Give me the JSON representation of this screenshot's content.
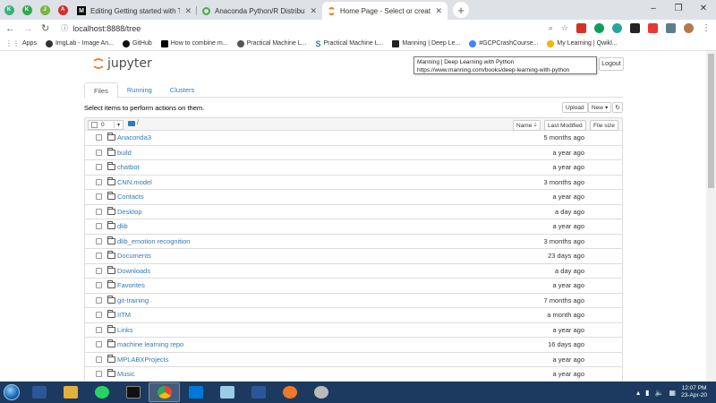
{
  "browser": {
    "tabs": [
      {
        "title": "Editing Getting started with Tens",
        "icon": "medium-icon",
        "active": false
      },
      {
        "title": "Anaconda Python/R Distribution",
        "icon": "anaconda-icon",
        "active": false
      },
      {
        "title": "Home Page - Select or create a n",
        "icon": "jupyter-icon",
        "active": true
      }
    ],
    "new_tab_label": "+",
    "url": "localhost:8888/tree",
    "bookmarks": [
      {
        "label": "Apps",
        "icon": "apps-grid-icon"
      },
      {
        "label": "ImgLab - Image An...",
        "icon": "imglab-icon"
      },
      {
        "label": "GitHub",
        "icon": "github-icon"
      },
      {
        "label": "How to combine m...",
        "icon": "medium-icon"
      },
      {
        "label": "Practical Machine L...",
        "icon": "globe-icon"
      },
      {
        "label": "Practical Machine L...",
        "icon": "scribd-icon"
      },
      {
        "label": "Manning | Deep Le...",
        "icon": "manning-icon"
      },
      {
        "label": "#GCPCrashCourse...",
        "icon": "gcp-icon"
      },
      {
        "label": "My Learning | Qwikl...",
        "icon": "qwiklabs-icon"
      }
    ]
  },
  "tooltip": {
    "line1": "Manning | Deep Learning with Python",
    "line2": "https://www.manning.com/books/deep-learning-with-python"
  },
  "jupyter": {
    "logo_text": "jupyter",
    "logout_label": "Logout",
    "tabs": [
      "Files",
      "Running",
      "Clusters"
    ],
    "select_hint": "Select items to perform actions on them.",
    "upload_label": "Upload",
    "new_label": "New",
    "selected_count": "0",
    "root_path": "/",
    "sort": {
      "name": "Name",
      "modified": "Last Modified",
      "size": "File size"
    },
    "files": [
      {
        "name": "Anaconda3",
        "modified": "5 months ago"
      },
      {
        "name": "build",
        "modified": "a year ago"
      },
      {
        "name": "chatbot",
        "modified": "a year ago"
      },
      {
        "name": "CNN.model",
        "modified": "3 months ago"
      },
      {
        "name": "Contacts",
        "modified": "a year ago"
      },
      {
        "name": "Desktop",
        "modified": "a day ago"
      },
      {
        "name": "dlib",
        "modified": "a year ago"
      },
      {
        "name": "dlib_emotion recognition",
        "modified": "3 months ago"
      },
      {
        "name": "Documents",
        "modified": "23 days ago"
      },
      {
        "name": "Downloads",
        "modified": "a day ago"
      },
      {
        "name": "Favorites",
        "modified": "a year ago"
      },
      {
        "name": "git-training",
        "modified": "7 months ago"
      },
      {
        "name": "IITM",
        "modified": "a month ago"
      },
      {
        "name": "Links",
        "modified": "a year ago"
      },
      {
        "name": "machine learning repo",
        "modified": "16 days ago"
      },
      {
        "name": "MPLABXProjects",
        "modified": "a year ago"
      },
      {
        "name": "Music",
        "modified": "a year ago"
      }
    ]
  },
  "taskbar": {
    "time": "12:07 PM",
    "date": "23-Apr-20"
  },
  "colors": {
    "link": "#337ab7",
    "taskbar": "#1c3a5f",
    "tabstrip": "#dee1e6"
  }
}
